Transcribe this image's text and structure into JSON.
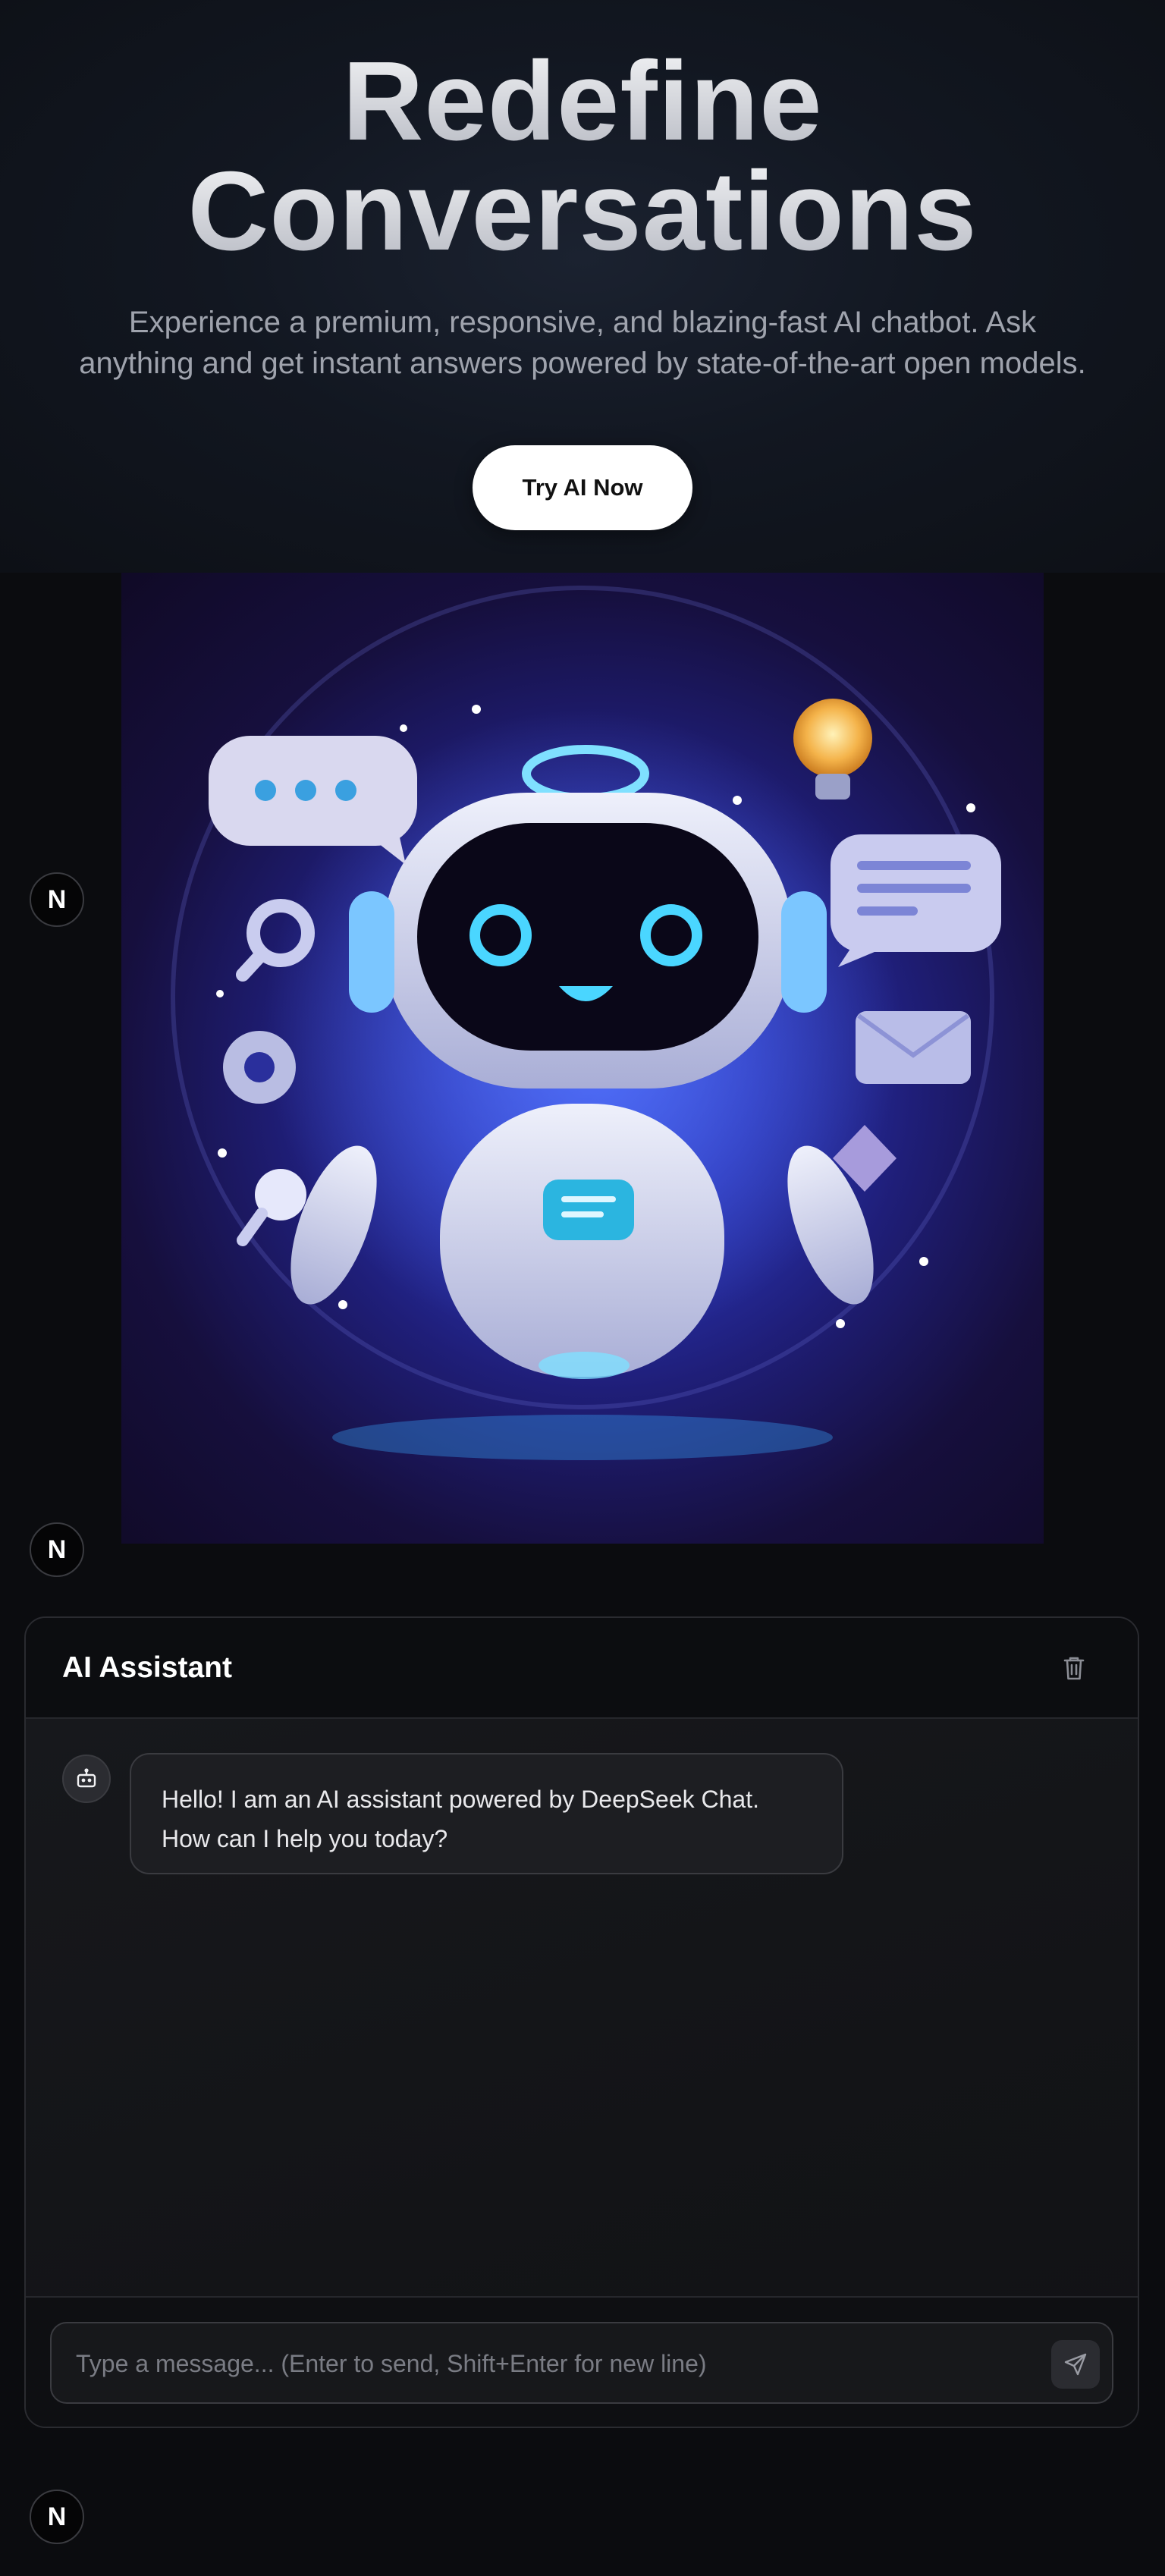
{
  "hero": {
    "title_line1": "Redefine",
    "title_line2": "Conversations",
    "subtitle_line1": "Experience a premium, responsive, and blazing-fast AI chatbot. Ask",
    "subtitle_line2": "anything and get instant answers powered by state-of-the-art open models.",
    "cta_label": "Try AI Now"
  },
  "badges": {
    "letter": "N"
  },
  "illustration": {
    "icon": "robot-assistant-illustration"
  },
  "chat": {
    "title": "AI Assistant",
    "clear_icon": "trash-icon",
    "messages": [
      {
        "role": "assistant",
        "avatar_icon": "bot-icon",
        "line1": "Hello! I am an AI assistant powered by DeepSeek Chat.",
        "line2": "How can I help you today?"
      }
    ],
    "input": {
      "placeholder": "Type a message... (Enter to send, Shift+Enter for new line)",
      "value": ""
    },
    "send_icon": "send-icon"
  },
  "colors": {
    "background": "#0b0c0f",
    "cta_background": "#ffffff",
    "panel_border": "#2a2b30"
  }
}
